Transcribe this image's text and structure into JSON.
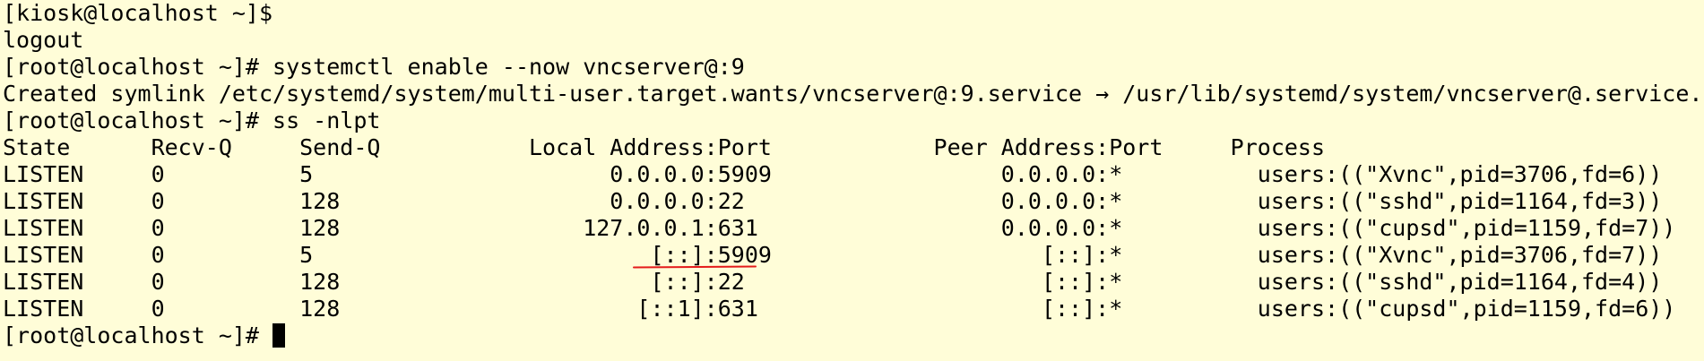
{
  "colors": {
    "background": "#fffdd8",
    "text": "#000000",
    "annotation": "#e41b1b"
  },
  "terminal": {
    "lines": [
      "[kiosk@localhost ~]$",
      "logout",
      "[root@localhost ~]# systemctl enable --now vncserver@:9",
      "Created symlink /etc/systemd/system/multi-user.target.wants/vncserver@:9.service → /usr/lib/systemd/system/vncserver@.service.",
      "[root@localhost ~]# ss -nlpt",
      "State      Recv-Q     Send-Q           Local Address:Port            Peer Address:Port     Process",
      "LISTEN     0          5                      0.0.0.0:5909                 0.0.0.0:*          users:((\"Xvnc\",pid=3706,fd=6))",
      "LISTEN     0          128                    0.0.0.0:22                   0.0.0.0:*          users:((\"sshd\",pid=1164,fd=3))",
      "LISTEN     0          128                  127.0.0.1:631                  0.0.0.0:*          users:((\"cupsd\",pid=1159,fd=7))",
      "LISTEN     0          5                         [::]:5909                    [::]:*          users:((\"Xvnc\",pid=3706,fd=7))",
      "LISTEN     0          128                       [::]:22                      [::]:*          users:((\"sshd\",pid=1164,fd=4))",
      "LISTEN     0          128                      [::1]:631                     [::]:*          users:((\"cupsd\",pid=1159,fd=6))"
    ],
    "prompt": "[root@localhost ~]# "
  }
}
